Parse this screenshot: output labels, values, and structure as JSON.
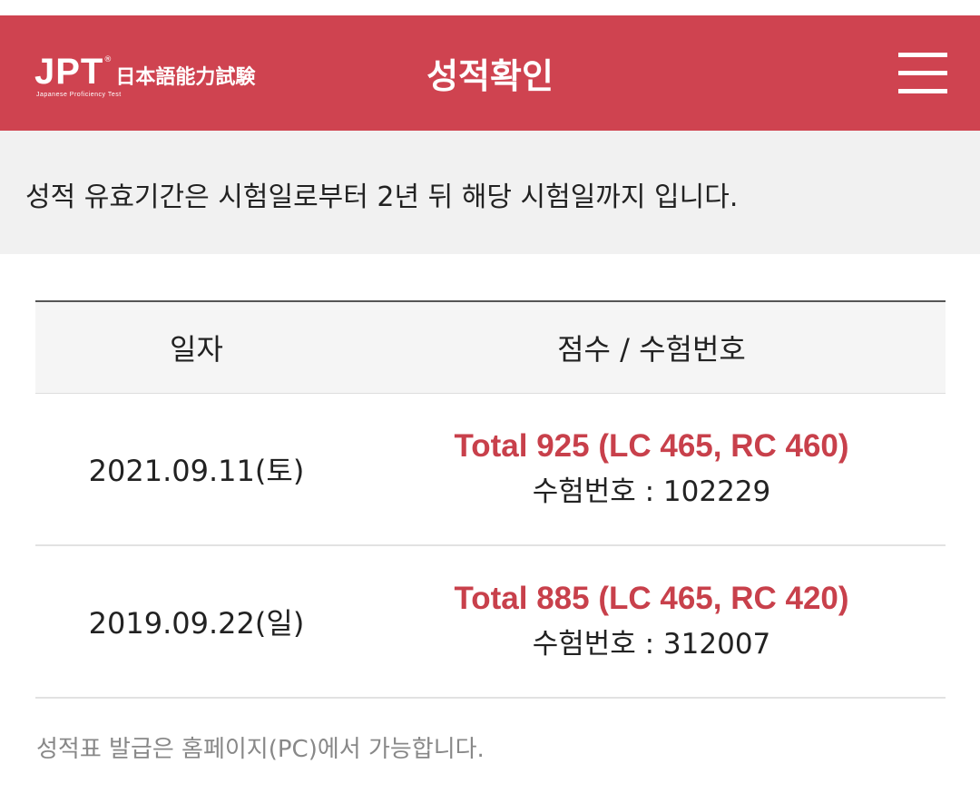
{
  "header": {
    "logo_text": "JPT",
    "logo_registered": "®",
    "logo_kanji": "日本語能力試験",
    "logo_subtitle": "Japanese Proficiency Test",
    "title": "성적확인",
    "menu_icon": "hamburger-menu-icon"
  },
  "notice": "성적 유효기간은 시험일로부터 2년 뒤 해당 시험일까지 입니다.",
  "table": {
    "headers": [
      "일자",
      "점수 / 수험번호"
    ],
    "rows": [
      {
        "date": "2021.09.11(토)",
        "score": "Total 925 (LC 465, RC 460)",
        "exam_no": "수험번호 : 102229"
      },
      {
        "date": "2019.09.22(일)",
        "score": "Total 885 (LC 465, RC 420)",
        "exam_no": "수험번호 : 312007"
      }
    ]
  },
  "footer_note": "성적표 발급은 홈페이지(PC)에서 가능합니다.",
  "colors": {
    "brand": "#cf4350",
    "score_text": "#c8404b",
    "notice_bg": "#f1f1f1"
  }
}
